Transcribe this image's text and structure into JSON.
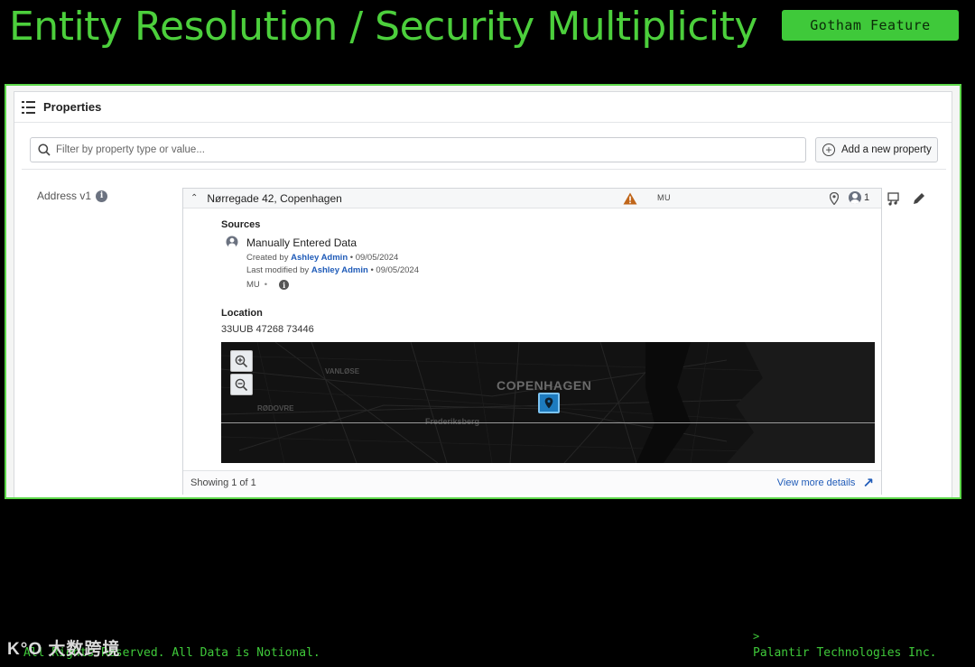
{
  "slide": {
    "title": "Entity Resolution / Security Multiplicity",
    "badge": "Gotham Feature",
    "footer_left": "All Rights Reserved. All Data is Notional.",
    "footer_caret": ">",
    "footer_right": "Palantir Technologies Inc.",
    "watermark": "K°O 大数跨境"
  },
  "properties": {
    "title": "Properties",
    "filter_placeholder": "Filter by property type or value...",
    "add_button": "Add a new property"
  },
  "address": {
    "label": "Address v1",
    "value": "Nørregade 42, Copenhagen",
    "marking": "MU",
    "people_count": "1",
    "sources_label": "Sources",
    "source_title": "Manually Entered Data",
    "created_prefix": "Created by",
    "created_by": "Ashley Admin",
    "created_suffix": "• 09/05/2024",
    "modified_prefix": "Last modified by",
    "modified_by": "Ashley Admin",
    "modified_suffix": "• 09/05/2024",
    "source_marking": "MU",
    "source_marking_sep": "•",
    "location_label": "Location",
    "location_value": "33UUB 47268 73446",
    "showing": "Showing 1 of 1",
    "view_more": "View more details",
    "view_more_icon": "↗"
  },
  "map": {
    "city_label": "COPENHAGEN",
    "label_vanlose": "VANLØSE",
    "label_rodovre": "RØDOVRE",
    "label_frederiksberg": "Frederiksberg"
  },
  "colors": {
    "accent_green": "#3fc93a",
    "link_blue": "#1f5bb8",
    "warning": "#c0661a"
  }
}
